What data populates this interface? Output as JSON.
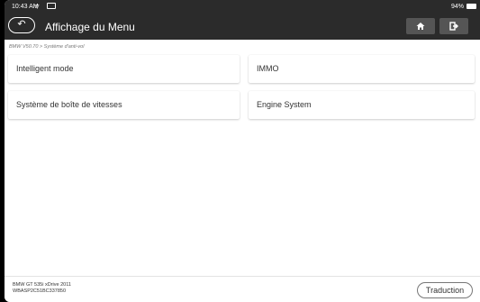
{
  "statusbar": {
    "time": "10:43 AM",
    "battery": "94%"
  },
  "header": {
    "title": "Affichage du Menu",
    "back_icon": "undo-icon",
    "home_icon": "home-icon",
    "exit_icon": "exit-icon"
  },
  "breadcrumb": "BMW V50.70 > Système d'anti-vol",
  "menu": {
    "items": [
      {
        "label": "Intelligent mode"
      },
      {
        "label": "IMMO"
      },
      {
        "label": "Système de boîte de vitesses"
      },
      {
        "label": "Engine System"
      }
    ]
  },
  "footer": {
    "vehicle_model": "BMW GT 535i xDrive 2011",
    "vin": "WBASP2C51BC337850",
    "translate_label": "Traduction"
  }
}
